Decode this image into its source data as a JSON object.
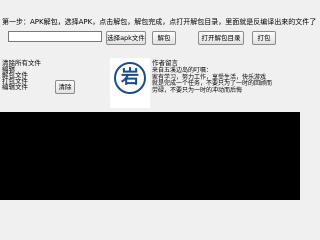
{
  "instructions": "第一步：APK解包，选择APK，点击解包，解包完成，点打开解包目录，里面就是反编译出来的文件了",
  "buttons": {
    "select_apk": "选择apk文件",
    "unpack": "解包",
    "open_dir": "打开解包目录",
    "pack": "打包",
    "clear": "清除"
  },
  "path_input": {
    "value": ""
  },
  "clear_section": {
    "label": "清除所有文件",
    "files": [
      "编辑",
      "解包文件",
      "打包文件",
      "编辑文件"
    ]
  },
  "logo": {
    "char": "岩",
    "caption": ""
  },
  "author_message": {
    "title": "作者留言",
    "body": "来自五溪边岛的叮嘱：\n家有学习，努力工作，享受生活，快乐游戏\n就是完成一个任务，不要只为了一时的回顾而\n劳碌，不要只为一时的冲动而后悔"
  },
  "console": {
    "text": ""
  },
  "colors": {
    "console_bg": "#000000",
    "logo_blue": "#1a4c8c"
  }
}
